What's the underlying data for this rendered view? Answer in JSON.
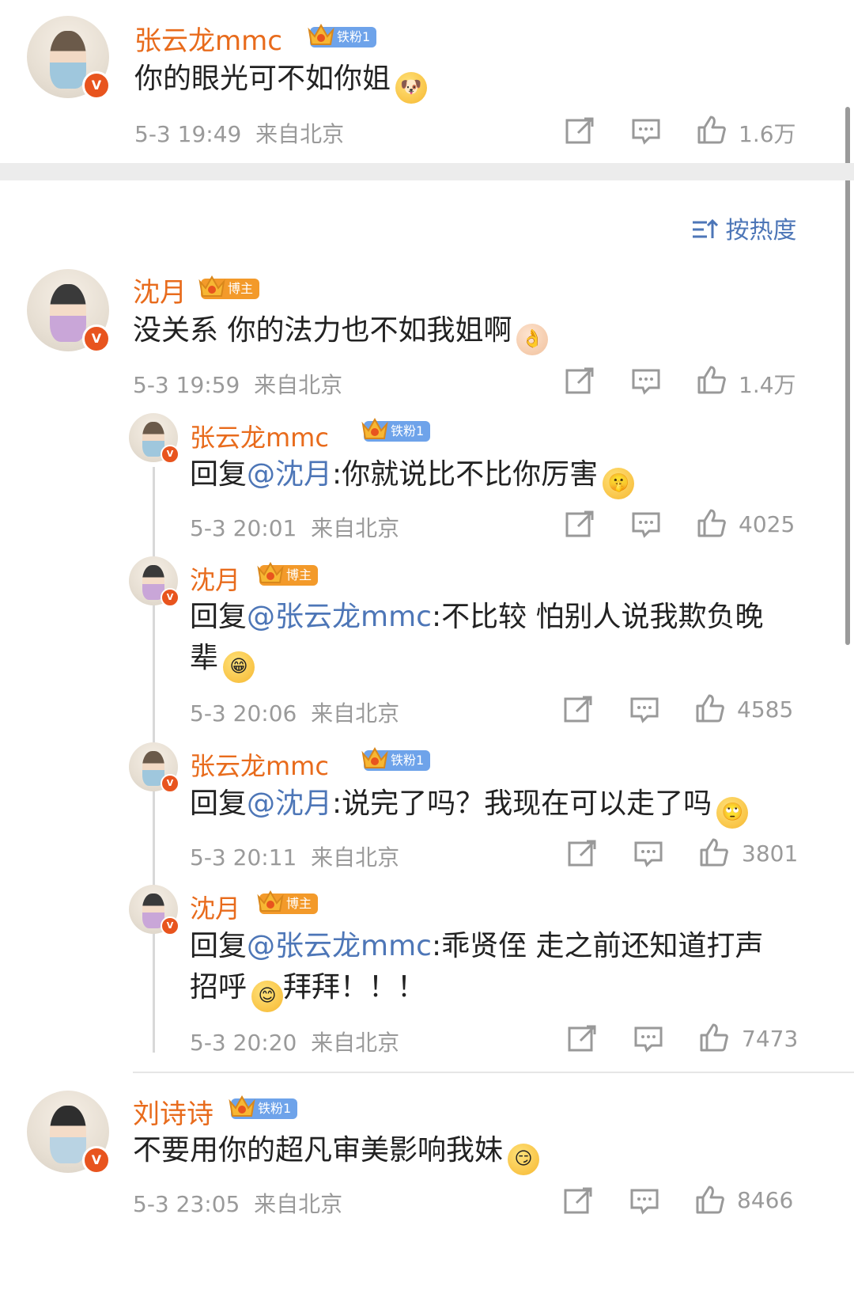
{
  "sort_label": "按热度",
  "comments": [
    {
      "name": "张云龙mmc",
      "badge": "铁粉1",
      "badge_type": "fan",
      "text": "你的眼光可不如你姐",
      "emoji": "doge-emoji",
      "time": "5-3 19:49",
      "location": "来自北京",
      "likes": "1.6万"
    },
    {
      "name": "沈月",
      "badge": "博主",
      "badge_type": "host",
      "text": "没关系 你的法力也不如我姐啊",
      "emoji": "ok-hand-emoji",
      "time": "5-3 19:59",
      "location": "来自北京",
      "likes": "1.4万",
      "replies": [
        {
          "name": "张云龙mmc",
          "badge": "铁粉1",
          "badge_type": "fan",
          "prefix": "回复",
          "mention": "@沈月",
          "text": ":你就说比不比你厉害",
          "emoji": "shh-emoji",
          "time": "5-3 20:01",
          "location": "来自北京",
          "likes": "4025"
        },
        {
          "name": "沈月",
          "badge": "博主",
          "badge_type": "host",
          "prefix": "回复",
          "mention": "@张云龙mmc",
          "text": ":不比较 怕别人说我欺负晚",
          "text2": "辈",
          "emoji": "grin-emoji",
          "time": "5-3 20:06",
          "location": "来自北京",
          "likes": "4585"
        },
        {
          "name": "张云龙mmc",
          "badge": "铁粉1",
          "badge_type": "fan",
          "prefix": "回复",
          "mention": "@沈月",
          "text": ":说完了吗？我现在可以走了吗",
          "emoji": "eye-roll-emoji",
          "time": "5-3 20:11",
          "location": "来自北京",
          "likes": "3801"
        },
        {
          "name": "沈月",
          "badge": "博主",
          "badge_type": "host",
          "prefix": "回复",
          "mention": "@张云龙mmc",
          "text": ":乖贤侄 走之前还知道打声",
          "text2": "招呼",
          "emoji": "smile-emoji",
          "text3": "拜拜！！！",
          "time": "5-3 20:20",
          "location": "来自北京",
          "likes": "7473"
        }
      ]
    },
    {
      "name": "刘诗诗",
      "badge": "铁粉1",
      "badge_type": "fan",
      "text": "不要用你的超凡审美影响我妹",
      "emoji": "smirk-emoji",
      "time": "5-3 23:05",
      "location": "来自北京",
      "likes": "8466"
    }
  ]
}
